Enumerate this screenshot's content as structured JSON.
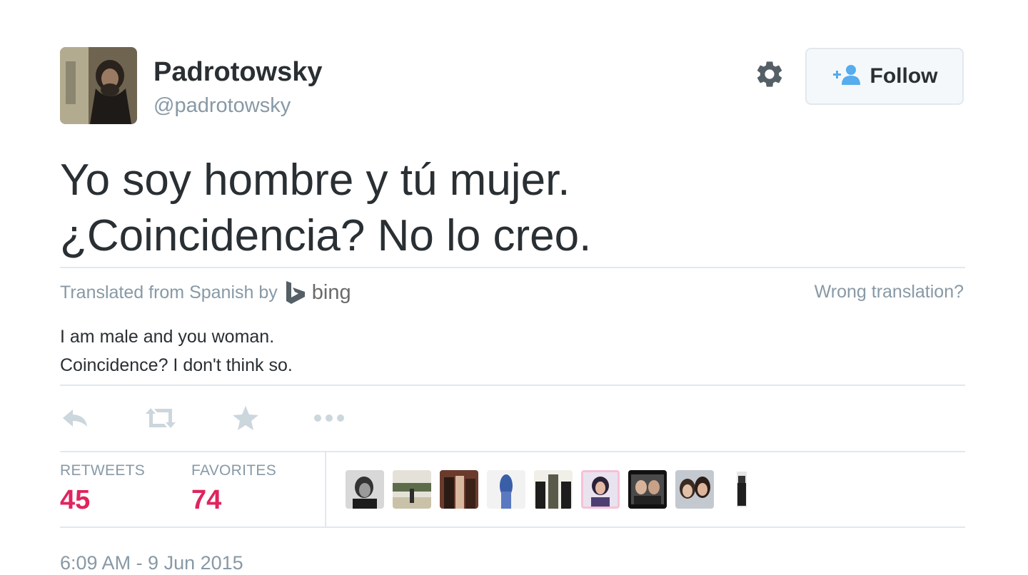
{
  "user": {
    "fullname": "Padrotowsky",
    "username": "@padrotowsky",
    "follow_label": "Follow"
  },
  "tweet": {
    "lines": [
      "Yo soy hombre y tú mujer.",
      "¿Coincidencia? No lo creo."
    ]
  },
  "translation": {
    "prefix": "Translated from Spanish by",
    "provider": "bing",
    "wrong_link": "Wrong translation?",
    "lines": [
      "I am male and you woman.",
      "Coincidence? I don't think so."
    ]
  },
  "actions": [
    "reply-icon",
    "retweet-icon",
    "favorite-icon",
    "more-icon"
  ],
  "stats": {
    "retweets_label": "RETWEETS",
    "retweets_count": "45",
    "favorites_label": "FAVORITES",
    "favorites_count": "74"
  },
  "timestamp": "6:09 AM - 9 Jun 2015",
  "colors": {
    "accent": "#55acee",
    "count": "#e0245e",
    "muted": "#8899a6",
    "text": "#292f33",
    "border": "#e1e8ed"
  }
}
